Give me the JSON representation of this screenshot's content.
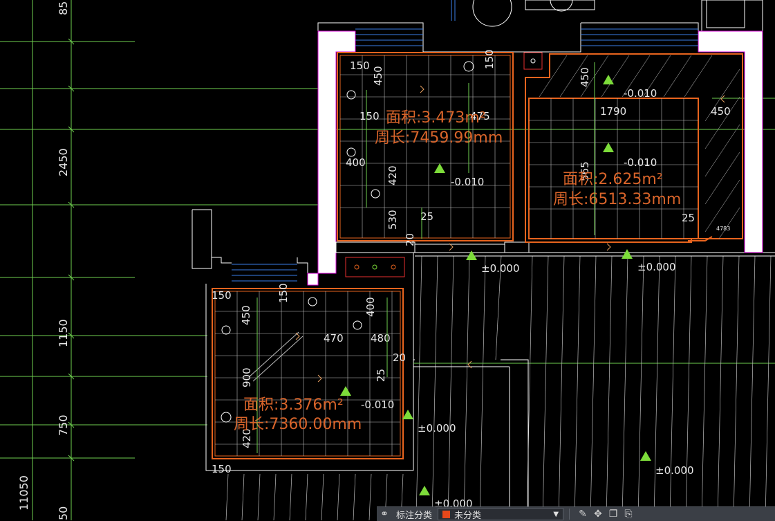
{
  "axis_dimensions": [
    "85",
    "2450",
    "1150",
    "750",
    "11050",
    "50"
  ],
  "room_top_left": {
    "area": "面积:3.473m²",
    "perimeter": "周长:7459.99mm",
    "dims": [
      "150",
      "450",
      "150",
      "420",
      "400",
      "530",
      "25",
      "20",
      "150"
    ],
    "level": "-0.010",
    "overlap_dim": "475"
  },
  "room_top_right": {
    "area": "面积:2.625m²",
    "perimeter": "周长:6513.33mm",
    "dims": [
      "450",
      "1790",
      "450",
      "565",
      "25"
    ],
    "levels": [
      "-0.010",
      "-0.010"
    ],
    "small_tag": "4783"
  },
  "room_bottom_left": {
    "area": "面积:3.376m²",
    "perimeter": "周长:7360.00mm",
    "dims": [
      "150",
      "450",
      "150",
      "400",
      "470",
      "480",
      "20",
      "25",
      "900",
      "420",
      "150"
    ],
    "level": "-0.010"
  },
  "floor_levels": [
    "±0.000",
    "±0.000",
    "±0.000",
    "±0.000",
    "±0.000"
  ],
  "toolbar": {
    "label": "标注分类",
    "category_value": "未分类",
    "swatch_color": "#e8481a"
  },
  "colors": {
    "room_outline": "#e8641e",
    "grid_line": "#7ddc5a",
    "wall": "#ffffff",
    "wall_border": "#e000e0",
    "level_marker": "#7ddc3a",
    "window_blue": "#3a7ee8",
    "area_text": "#d8642a"
  }
}
